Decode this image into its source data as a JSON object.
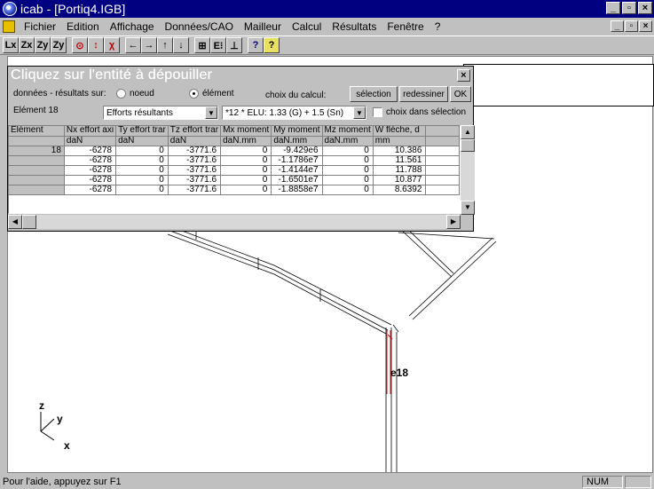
{
  "window": {
    "title": "icab - [Portiq4.IGB]",
    "minimize": "_",
    "maximize": "B",
    "close": "×"
  },
  "menu": {
    "items": [
      "Fichier",
      "Edition",
      "Affichage",
      "Données/CAO",
      "Mailleur",
      "Calcul",
      "Résultats",
      "Fenêtre",
      "?"
    ]
  },
  "toolbar": {
    "buttons": [
      {
        "icon": "view-x-icon",
        "glyph": "Lx"
      },
      {
        "icon": "view-zx-icon",
        "glyph": "Zx"
      },
      {
        "icon": "view-zy-icon",
        "glyph": "Zy"
      },
      {
        "icon": "view-3d-icon",
        "glyph": "Zy"
      },
      {
        "icon": "target-icon",
        "glyph": "⊙"
      },
      {
        "icon": "vertical-move-icon",
        "glyph": "↕"
      },
      {
        "icon": "cross-section-icon",
        "glyph": "χ"
      },
      {
        "icon": "arrow-left-icon",
        "glyph": "←"
      },
      {
        "icon": "arrow-right-icon",
        "glyph": "→"
      },
      {
        "icon": "arrow-up-icon",
        "glyph": "↑"
      },
      {
        "icon": "arrow-down-icon",
        "glyph": "↓"
      },
      {
        "icon": "mesh-icon",
        "glyph": "⊞"
      },
      {
        "icon": "element-info-icon",
        "glyph": "E⁝"
      },
      {
        "icon": "support-icon",
        "glyph": "⊥"
      },
      {
        "icon": "context-help-icon",
        "glyph": "?"
      },
      {
        "icon": "help-icon",
        "glyph": "?"
      }
    ]
  },
  "dialog": {
    "title": "Cliquez sur l'entité à dépouiller",
    "data_label": "données - résultats sur:",
    "radio_node": "noeud",
    "radio_element": "élément",
    "choix_calcul_label": "choix du calcul:",
    "selection_button": "sélection",
    "redessiner_button": "redessiner",
    "ok_button": "OK",
    "element_label": "Elément 18",
    "result_type": "Efforts résultants",
    "load_case": "*12 * ELU: 1.33 (G) + 1.5 (Sn)",
    "checkbox_label": "choix dans sélection",
    "close": "×"
  },
  "grid": {
    "headers": [
      "Elément",
      "Nx effort axi",
      "Ty effort trar",
      "Tz effort trar",
      "Mx moment",
      "My moment",
      "Mz moment",
      "W  flèche, d"
    ],
    "units": [
      "",
      "daN",
      "daN",
      "daN",
      "daN.mm",
      "daN.mm",
      "daN.mm",
      "mm"
    ],
    "rows": [
      [
        "18",
        "-6278",
        "0",
        "-3771.6",
        "0",
        "-9.429e6",
        "0",
        "10.386"
      ],
      [
        "",
        "-6278",
        "0",
        "-3771.6",
        "0",
        "-1.1786e7",
        "0",
        "11.561"
      ],
      [
        "",
        "-6278",
        "0",
        "-3771.6",
        "0",
        "-1.4144e7",
        "0",
        "11.788"
      ],
      [
        "",
        "-6278",
        "0",
        "-3771.6",
        "0",
        "-1.6501e7",
        "0",
        "10.877"
      ],
      [
        "",
        "-6278",
        "0",
        "-3771.6",
        "0",
        "-1.8858e7",
        "0",
        "8.6392"
      ]
    ]
  },
  "model": {
    "element_label": "e18",
    "axis_z": "z",
    "axis_y": "y",
    "axis_x": "x",
    "highlight_color": "#d00000"
  },
  "status": {
    "message": "Pour l'aide, appuyez sur F1",
    "num": "NUM"
  }
}
